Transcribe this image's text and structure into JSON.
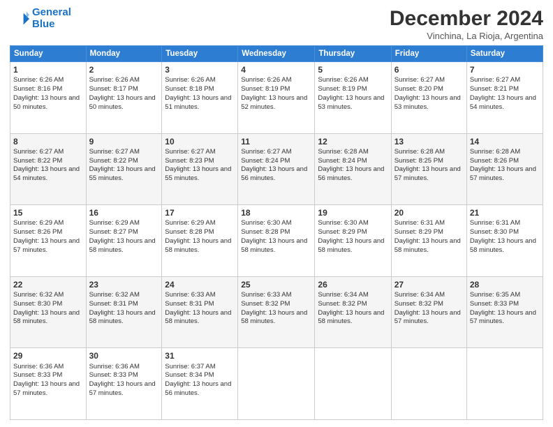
{
  "logo": {
    "line1": "General",
    "line2": "Blue"
  },
  "title": "December 2024",
  "location": "Vinchina, La Rioja, Argentina",
  "days_of_week": [
    "Sunday",
    "Monday",
    "Tuesday",
    "Wednesday",
    "Thursday",
    "Friday",
    "Saturday"
  ],
  "weeks": [
    [
      {
        "day": "1",
        "sunrise": "Sunrise: 6:26 AM",
        "sunset": "Sunset: 8:16 PM",
        "daylight": "Daylight: 13 hours and 50 minutes."
      },
      {
        "day": "2",
        "sunrise": "Sunrise: 6:26 AM",
        "sunset": "Sunset: 8:17 PM",
        "daylight": "Daylight: 13 hours and 50 minutes."
      },
      {
        "day": "3",
        "sunrise": "Sunrise: 6:26 AM",
        "sunset": "Sunset: 8:18 PM",
        "daylight": "Daylight: 13 hours and 51 minutes."
      },
      {
        "day": "4",
        "sunrise": "Sunrise: 6:26 AM",
        "sunset": "Sunset: 8:19 PM",
        "daylight": "Daylight: 13 hours and 52 minutes."
      },
      {
        "day": "5",
        "sunrise": "Sunrise: 6:26 AM",
        "sunset": "Sunset: 8:19 PM",
        "daylight": "Daylight: 13 hours and 53 minutes."
      },
      {
        "day": "6",
        "sunrise": "Sunrise: 6:27 AM",
        "sunset": "Sunset: 8:20 PM",
        "daylight": "Daylight: 13 hours and 53 minutes."
      },
      {
        "day": "7",
        "sunrise": "Sunrise: 6:27 AM",
        "sunset": "Sunset: 8:21 PM",
        "daylight": "Daylight: 13 hours and 54 minutes."
      }
    ],
    [
      {
        "day": "8",
        "sunrise": "Sunrise: 6:27 AM",
        "sunset": "Sunset: 8:22 PM",
        "daylight": "Daylight: 13 hours and 54 minutes."
      },
      {
        "day": "9",
        "sunrise": "Sunrise: 6:27 AM",
        "sunset": "Sunset: 8:22 PM",
        "daylight": "Daylight: 13 hours and 55 minutes."
      },
      {
        "day": "10",
        "sunrise": "Sunrise: 6:27 AM",
        "sunset": "Sunset: 8:23 PM",
        "daylight": "Daylight: 13 hours and 55 minutes."
      },
      {
        "day": "11",
        "sunrise": "Sunrise: 6:27 AM",
        "sunset": "Sunset: 8:24 PM",
        "daylight": "Daylight: 13 hours and 56 minutes."
      },
      {
        "day": "12",
        "sunrise": "Sunrise: 6:28 AM",
        "sunset": "Sunset: 8:24 PM",
        "daylight": "Daylight: 13 hours and 56 minutes."
      },
      {
        "day": "13",
        "sunrise": "Sunrise: 6:28 AM",
        "sunset": "Sunset: 8:25 PM",
        "daylight": "Daylight: 13 hours and 57 minutes."
      },
      {
        "day": "14",
        "sunrise": "Sunrise: 6:28 AM",
        "sunset": "Sunset: 8:26 PM",
        "daylight": "Daylight: 13 hours and 57 minutes."
      }
    ],
    [
      {
        "day": "15",
        "sunrise": "Sunrise: 6:29 AM",
        "sunset": "Sunset: 8:26 PM",
        "daylight": "Daylight: 13 hours and 57 minutes."
      },
      {
        "day": "16",
        "sunrise": "Sunrise: 6:29 AM",
        "sunset": "Sunset: 8:27 PM",
        "daylight": "Daylight: 13 hours and 58 minutes."
      },
      {
        "day": "17",
        "sunrise": "Sunrise: 6:29 AM",
        "sunset": "Sunset: 8:28 PM",
        "daylight": "Daylight: 13 hours and 58 minutes."
      },
      {
        "day": "18",
        "sunrise": "Sunrise: 6:30 AM",
        "sunset": "Sunset: 8:28 PM",
        "daylight": "Daylight: 13 hours and 58 minutes."
      },
      {
        "day": "19",
        "sunrise": "Sunrise: 6:30 AM",
        "sunset": "Sunset: 8:29 PM",
        "daylight": "Daylight: 13 hours and 58 minutes."
      },
      {
        "day": "20",
        "sunrise": "Sunrise: 6:31 AM",
        "sunset": "Sunset: 8:29 PM",
        "daylight": "Daylight: 13 hours and 58 minutes."
      },
      {
        "day": "21",
        "sunrise": "Sunrise: 6:31 AM",
        "sunset": "Sunset: 8:30 PM",
        "daylight": "Daylight: 13 hours and 58 minutes."
      }
    ],
    [
      {
        "day": "22",
        "sunrise": "Sunrise: 6:32 AM",
        "sunset": "Sunset: 8:30 PM",
        "daylight": "Daylight: 13 hours and 58 minutes."
      },
      {
        "day": "23",
        "sunrise": "Sunrise: 6:32 AM",
        "sunset": "Sunset: 8:31 PM",
        "daylight": "Daylight: 13 hours and 58 minutes."
      },
      {
        "day": "24",
        "sunrise": "Sunrise: 6:33 AM",
        "sunset": "Sunset: 8:31 PM",
        "daylight": "Daylight: 13 hours and 58 minutes."
      },
      {
        "day": "25",
        "sunrise": "Sunrise: 6:33 AM",
        "sunset": "Sunset: 8:32 PM",
        "daylight": "Daylight: 13 hours and 58 minutes."
      },
      {
        "day": "26",
        "sunrise": "Sunrise: 6:34 AM",
        "sunset": "Sunset: 8:32 PM",
        "daylight": "Daylight: 13 hours and 58 minutes."
      },
      {
        "day": "27",
        "sunrise": "Sunrise: 6:34 AM",
        "sunset": "Sunset: 8:32 PM",
        "daylight": "Daylight: 13 hours and 57 minutes."
      },
      {
        "day": "28",
        "sunrise": "Sunrise: 6:35 AM",
        "sunset": "Sunset: 8:33 PM",
        "daylight": "Daylight: 13 hours and 57 minutes."
      }
    ],
    [
      {
        "day": "29",
        "sunrise": "Sunrise: 6:36 AM",
        "sunset": "Sunset: 8:33 PM",
        "daylight": "Daylight: 13 hours and 57 minutes."
      },
      {
        "day": "30",
        "sunrise": "Sunrise: 6:36 AM",
        "sunset": "Sunset: 8:33 PM",
        "daylight": "Daylight: 13 hours and 57 minutes."
      },
      {
        "day": "31",
        "sunrise": "Sunrise: 6:37 AM",
        "sunset": "Sunset: 8:34 PM",
        "daylight": "Daylight: 13 hours and 56 minutes."
      },
      null,
      null,
      null,
      null
    ]
  ]
}
